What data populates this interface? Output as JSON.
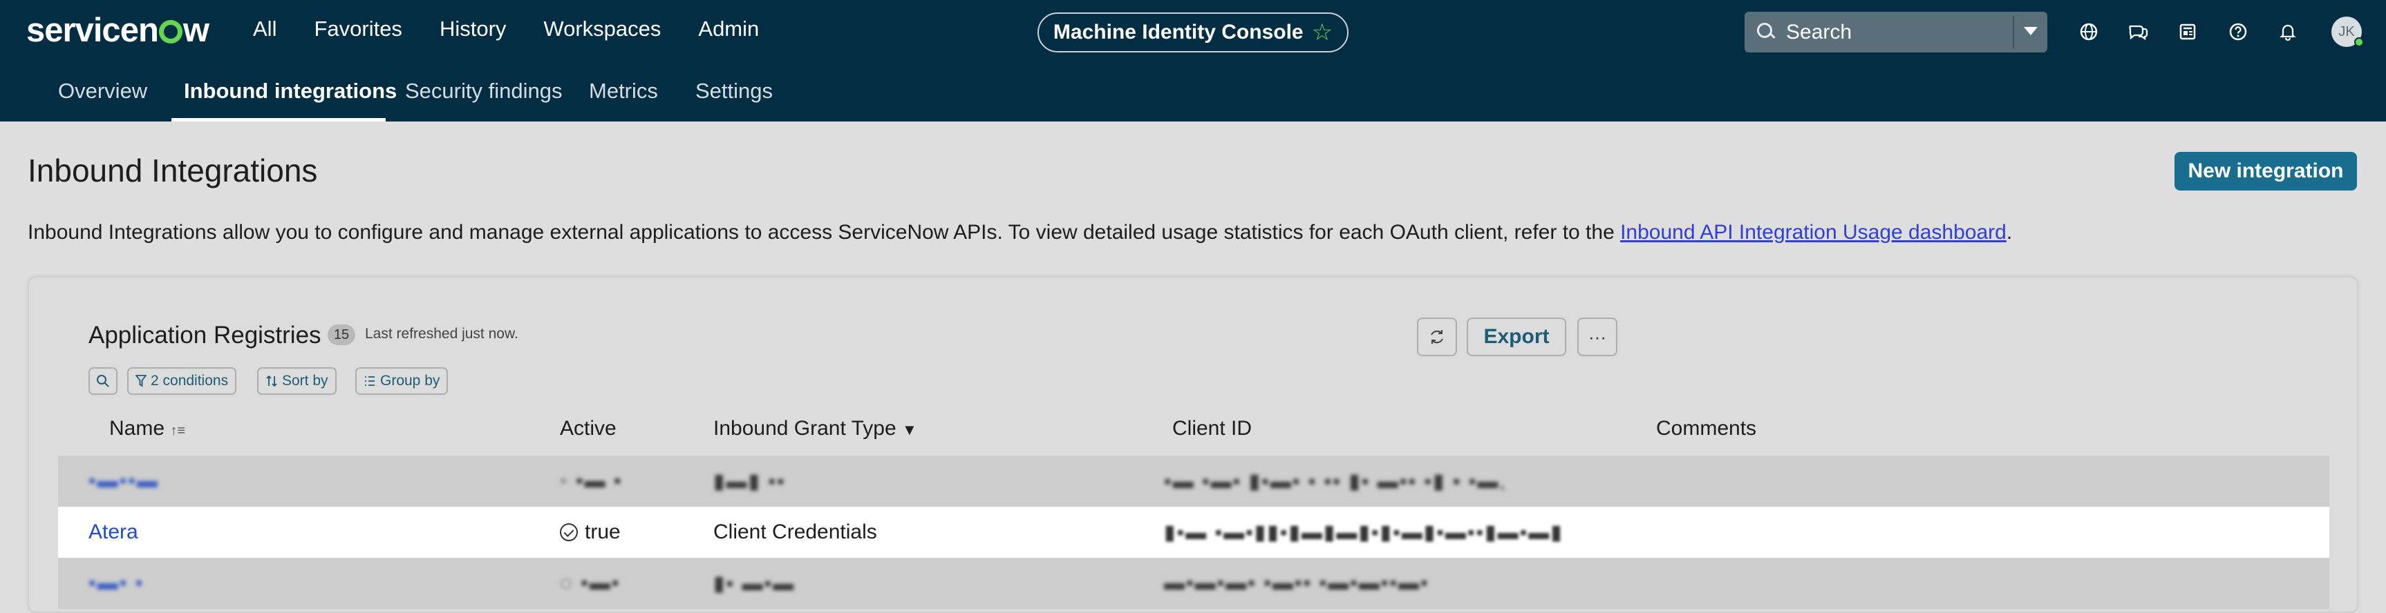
{
  "app": {
    "logo_text_a": "servicen",
    "logo_text_b": "w"
  },
  "topnav": {
    "items": [
      "All",
      "Favorites",
      "History",
      "Workspaces",
      "Admin"
    ]
  },
  "console": {
    "label": "Machine Identity Console",
    "star": "☆"
  },
  "search": {
    "placeholder": "Search"
  },
  "header_icons": [
    "globe-icon",
    "chat-icon",
    "news-icon",
    "help-icon",
    "bell-icon"
  ],
  "user": {
    "initials": "JK"
  },
  "subnav": {
    "tabs": [
      "Overview",
      "Inbound integrations",
      "Security findings",
      "Metrics",
      "Settings"
    ],
    "active": "Inbound integrations"
  },
  "page": {
    "title": "Inbound Integrations",
    "new_button": "New integration",
    "description": "Inbound Integrations allow you to configure and manage external applications to access ServiceNow APIs. To view detailed usage statistics for each OAuth client, refer to the ",
    "description_link": "Inbound API Integration Usage dashboard",
    "description_end": "."
  },
  "registry": {
    "title": "Application Registries",
    "count": "15",
    "refreshed": "Last refreshed just now.",
    "conditions": "2 conditions",
    "sort": "Sort by",
    "group": "Group by",
    "export": "Export",
    "more": "···"
  },
  "table": {
    "columns": [
      "Name",
      "Active",
      "Inbound Grant Type",
      "Client ID",
      "Comments"
    ],
    "rows": [
      {
        "name": "",
        "active": "",
        "grant": "",
        "client_id": "",
        "comments": ""
      },
      {
        "name": "Atera",
        "active": "true",
        "grant": "Client Credentials",
        "client_id": "",
        "comments": ""
      },
      {
        "name": "",
        "active": "",
        "grant": "",
        "client_id": "",
        "comments": ""
      }
    ]
  },
  "colors": {
    "topbar": "#032d42",
    "accent": "#196d8e",
    "brand_green": "#62d84e",
    "link": "#1f4cc4"
  }
}
